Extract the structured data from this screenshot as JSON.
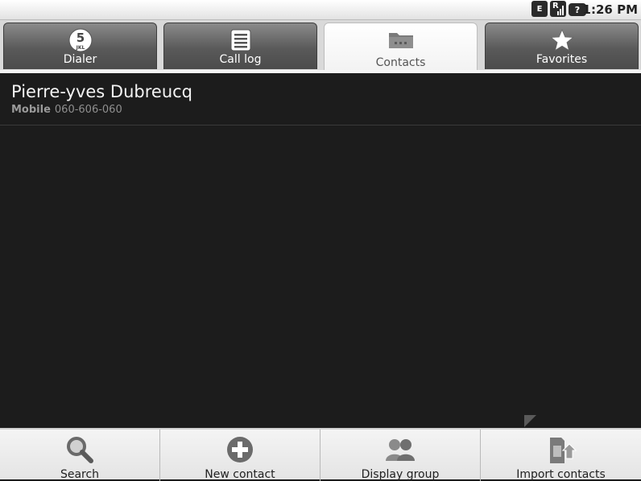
{
  "status_bar": {
    "signal_letter_e": "E",
    "signal_letter_r": "R",
    "unknown_icon": "?",
    "time": "1:26 PM"
  },
  "tabs": [
    {
      "label": "Dialer",
      "icon": "dialer-5-jkl-icon",
      "icon_digit": "5",
      "icon_letters": "JKL",
      "active": false
    },
    {
      "label": "Call log",
      "icon": "call-log-icon",
      "active": false
    },
    {
      "label": "Contacts",
      "icon": "contacts-folder-icon",
      "active": true
    },
    {
      "label": "Favorites",
      "icon": "star-icon",
      "active": false
    }
  ],
  "contacts": [
    {
      "name": "Pierre-yves Dubreucq",
      "phone_type": "Mobile",
      "phone": "060-606-060"
    }
  ],
  "menu": [
    {
      "label": "Search",
      "icon": "search-icon"
    },
    {
      "label": "New contact",
      "icon": "add-icon"
    },
    {
      "label": "Display group",
      "icon": "group-icon"
    },
    {
      "label": "Import contacts",
      "icon": "import-sim-icon"
    }
  ],
  "colors": {
    "background": "#1c1c1c",
    "tab_inactive": "#5a5a5a",
    "tab_active": "#ffffff",
    "menu_background": "#ececec"
  }
}
